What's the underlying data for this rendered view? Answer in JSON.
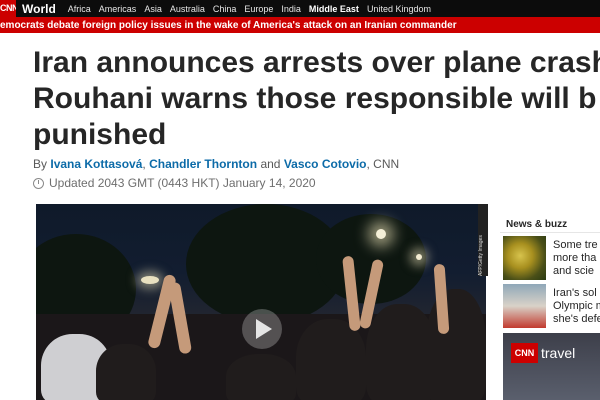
{
  "nav": {
    "logo": "CNN",
    "section": "World",
    "items": [
      "Africa",
      "Americas",
      "Asia",
      "Australia",
      "China",
      "Europe",
      "India",
      "Middle East",
      "United Kingdom"
    ],
    "active_item": "Middle East"
  },
  "ticker": {
    "text": "emocrats debate foreign policy issues in the wake of America's attack on an Iranian commander"
  },
  "article": {
    "headline_lines": [
      "Iran announces arrests over plane crash",
      "Rouhani warns those responsible will b",
      "punished"
    ],
    "byline_prefix": "By",
    "authors": [
      "Ivana Kottasová",
      "Chandler Thornton",
      "Vasco Cotovio"
    ],
    "byline_sep1": ",",
    "byline_and": "and",
    "byline_suffix": ", CNN",
    "updated": "Updated 2043 GMT (0443 HKT) January 14, 2020"
  },
  "video": {
    "credit": "AFP/Getty Images",
    "play_icon": "play-icon"
  },
  "sidebar": {
    "title": "News & buzz",
    "items": [
      {
        "lines": [
          "Some tre",
          "more tha",
          "and scie"
        ],
        "thumb": "tree"
      },
      {
        "lines": [
          "Iran's sol",
          "Olympic m",
          "she's defe"
        ],
        "thumb": "sport"
      }
    ],
    "ad": {
      "logo": "CNN",
      "word": "travel"
    }
  },
  "colors": {
    "nav_bg": "#0c0c0c",
    "brand_red": "#cc0000",
    "author_link": "#0c6ba8",
    "headline": "#262626"
  }
}
